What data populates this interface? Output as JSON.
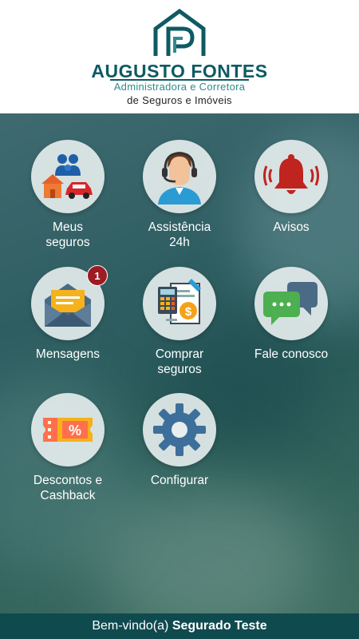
{
  "header": {
    "brand_name": "AUGUSTO FONTES",
    "subtitle_line1": "Administradora e Corretora",
    "subtitle_line2": "de Seguros e Imóveis"
  },
  "menu": {
    "items": [
      {
        "label_line1": "Meus",
        "label_line2": "seguros",
        "icon": "family-house-car-icon"
      },
      {
        "label_line1": "Assistência",
        "label_line2": "24h",
        "icon": "headset-agent-icon"
      },
      {
        "label_line1": "Avisos",
        "label_line2": "",
        "icon": "bell-icon"
      },
      {
        "label_line1": "Mensagens",
        "label_line2": "",
        "icon": "envelope-icon",
        "badge": "1"
      },
      {
        "label_line1": "Comprar",
        "label_line2": "seguros",
        "icon": "calculator-document-icon"
      },
      {
        "label_line1": "Fale conosco",
        "label_line2": "",
        "icon": "chat-bubbles-icon"
      },
      {
        "label_line1": "Descontos e",
        "label_line2": "Cashback",
        "icon": "discount-ticket-icon"
      },
      {
        "label_line1": "Configurar",
        "label_line2": "",
        "icon": "gear-icon"
      }
    ]
  },
  "footer": {
    "welcome_prefix": "Bem-vindo(a)",
    "user_name": "Segurado Teste"
  },
  "colors": {
    "brand": "#0e5a63",
    "badge": "#9d1b22",
    "footer_bg": "#0f4a4f"
  }
}
